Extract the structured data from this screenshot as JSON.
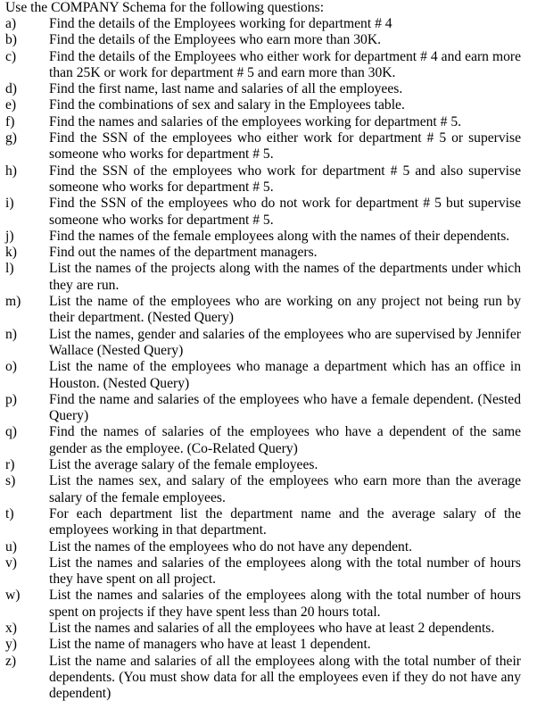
{
  "document": {
    "intro": "Use the COMPANY Schema for the following questions:",
    "questions": [
      {
        "label": "a)",
        "text": "Find the details of the Employees working for department # 4"
      },
      {
        "label": "b)",
        "text": "Find the details of the Employees who earn more than 30K."
      },
      {
        "label": "c)",
        "text": "Find the details of the Employees who either work for department # 4 and earn more than 25K or work for department # 5 and earn more than 30K."
      },
      {
        "label": "d)",
        "text": "Find the first name, last name and salaries of all the employees."
      },
      {
        "label": "e)",
        "text": "Find the combinations of sex and salary in the Employees table."
      },
      {
        "label": "f)",
        "text": "Find the names and salaries of the employees working for department # 5."
      },
      {
        "label": "g)",
        "text": "Find the SSN of the employees who either work for department # 5 or supervise someone who works for department # 5."
      },
      {
        "label": "h)",
        "text": "Find the SSN of the employees who work for department # 5 and also supervise someone who works for department # 5."
      },
      {
        "label": "i)",
        "text": "Find the SSN of the employees who do not work for department # 5 but supervise someone who works for department # 5."
      },
      {
        "label": "j)",
        "text": "Find the names of the female employees along with the names of their dependents."
      },
      {
        "label": "k)",
        "text": "Find out the names of the department managers."
      },
      {
        "label": "l)",
        "text": "List the names of the projects along with the names of the departments under which they are run."
      },
      {
        "label": "m)",
        "text": "List the name of the employees who are working on any project not being run by their department. (Nested Query)"
      },
      {
        "label": "n)",
        "text": "List the names, gender and salaries of the employees who are supervised by Jennifer Wallace (Nested Query)"
      },
      {
        "label": "o)",
        "text": "List the name of the employees who manage a department which has an office in Houston. (Nested Query)"
      },
      {
        "label": "p)",
        "text": " Find the name and salaries of the employees who have a female dependent. (Nested Query)"
      },
      {
        "label": "q)",
        "text": "Find the names of salaries of the employees who have a dependent of the same gender as the employee. (Co-Related Query)"
      },
      {
        "label": "r)",
        "text": "List the average salary of the female employees."
      },
      {
        "label": "s)",
        "text": "List the names sex, and salary of the employees who earn more than the average salary of the female employees."
      },
      {
        "label": "t)",
        "text": "For each department list the department name and the average salary of the employees working in that department."
      },
      {
        "label": "u)",
        "text": "List the names of the employees who do not have any dependent."
      },
      {
        "label": "v)",
        "text": "List the names and salaries of the employees along with the total number of hours they have spent on all project."
      },
      {
        "label": "w)",
        "text": "List the names and salaries of the employees along with the total number of hours spent on projects if they have spent less than 20 hours total."
      },
      {
        "label": "x)",
        "text": "List the names and salaries of all the employees who have at least 2 dependents."
      },
      {
        "label": "y)",
        "text": "List the name of managers who have at least 1 dependent."
      },
      {
        "label": "z)",
        "text": "List the name and salaries of all the employees along with the total number of their dependents. (You must show data for all the employees even if they do not have any dependent)"
      }
    ]
  }
}
